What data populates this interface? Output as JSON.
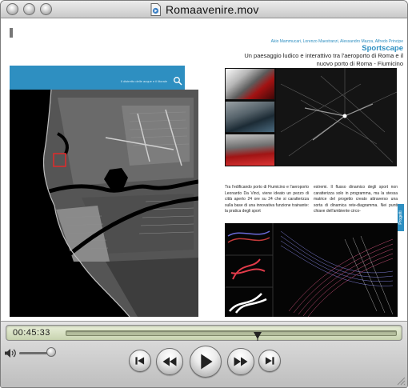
{
  "window": {
    "title": "Romaavenire.mov",
    "icon": "movie-document-icon"
  },
  "left_page": {
    "map_header_caption": "Il distretto delle acque e il litorale",
    "map_header_icon": "zoom-icon",
    "map_marker_color": "#e22b2b"
  },
  "right_page": {
    "authors": "Akio Mammucari, Lorenzo Maestranzi, Alessandro Mazza, Alfredo Principe",
    "title": "Sportscape",
    "subtitle": "Un paesaggio ludico e interattivo tra l'aeroporto di Roma e il nuovo porto di Roma - Fiumicino",
    "body_col1": "Tra l'edificando porto di Fiumicino e l'aeroporto Leonardo Da Vinci, viene ideato un pezzo di città aperto 24 ore su 24 che si caratterizza sulla base di una innovativa funzione trainante: la pratica degli sport",
    "body_col2": "estremi. Il flusso dinamico degli sport non caratterizza solo in programma, ma la stessa matrice del progetto creato attraverso una sorta di dinamica rete-diagramma. Nei punti chiave dell'ambiente circo-",
    "side_tab": "Progetti"
  },
  "player": {
    "current_time": "00:45:33",
    "progress": 0.58,
    "volume": 0.95,
    "buttons": {
      "start": "skip-to-start-icon",
      "rewind": "rewind-icon",
      "play": "play-icon",
      "fast_forward": "fast-forward-icon",
      "end": "skip-to-end-icon"
    },
    "scrubber_color": "#c8d3b0",
    "accent": "#2e8fc1"
  }
}
